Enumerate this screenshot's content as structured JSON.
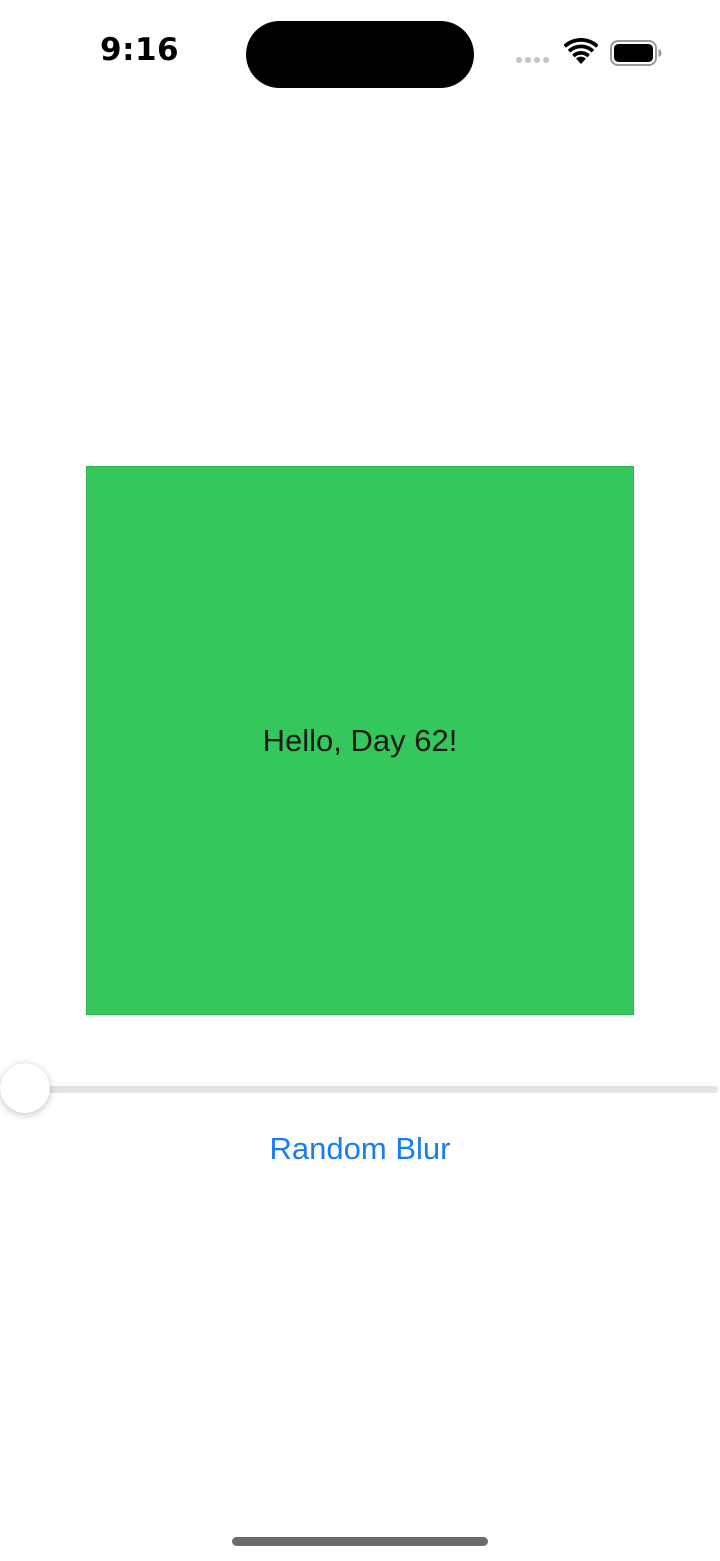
{
  "status_bar": {
    "time": "9:16",
    "icons": [
      "signal-dots-icon",
      "wifi-icon",
      "battery-icon"
    ]
  },
  "card": {
    "text": "Hello, Day 62!",
    "color": "#36c75c"
  },
  "slider": {
    "value": 0,
    "min": 0,
    "max": 1,
    "accent": "#0a7aff"
  },
  "button": {
    "label": "Random Blur",
    "color": "#1a7cf5"
  }
}
